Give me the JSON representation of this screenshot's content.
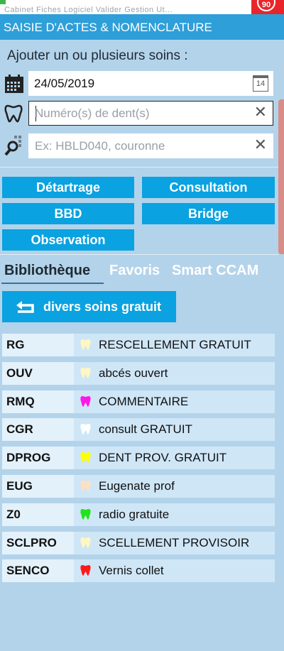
{
  "top_menu": "Cabinet  Fiches  Logiciel  Valider  Gestion  Ut...",
  "badge": "90",
  "title": "SAISIE D'ACTES & NOMENCLATURE",
  "subtitle": "Ajouter un ou plusieurs soins :",
  "date_field": {
    "value": "24/05/2019",
    "calendar_day": "14"
  },
  "teeth_field": {
    "placeholder": "Numéro(s) de dent(s)"
  },
  "search_field": {
    "placeholder": "Ex: HBLD040, couronne"
  },
  "clear_glyph": "✕",
  "quick_buttons": [
    "Détartrage",
    "Consultation",
    "BBD",
    "Bridge",
    "Observation"
  ],
  "tabs": [
    "Bibliothèque",
    "Favoris",
    "Smart CCAM"
  ],
  "back_button": "divers soins gratuit",
  "acts": [
    {
      "code": "RG",
      "desc": "RESCELLEMENT GRATUIT",
      "color": "#fff7c2"
    },
    {
      "code": "OUV",
      "desc": "abcés ouvert",
      "color": "#fff7c2"
    },
    {
      "code": "RMQ",
      "desc": "COMMENTAIRE",
      "color": "#ff17e8"
    },
    {
      "code": "CGR",
      "desc": "consult GRATUIT",
      "color": "#ffffff"
    },
    {
      "code": "DPROG",
      "desc": "DENT PROV. GRATUIT",
      "color": "#ffff00"
    },
    {
      "code": "EUG",
      "desc": "Eugenate prof",
      "color": "#ffe0c2"
    },
    {
      "code": "Z0",
      "desc": "radio gratuite",
      "color": "#22e31c"
    },
    {
      "code": "SCLPRO",
      "desc": "SCELLEMENT PROVISOIR",
      "color": "#fff7c2"
    },
    {
      "code": "SENCO",
      "desc": "Vernis collet",
      "color": "#ff1a1a"
    }
  ]
}
